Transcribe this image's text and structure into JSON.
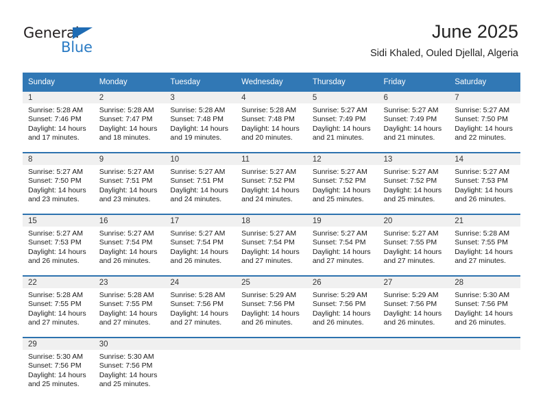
{
  "brand": {
    "name_top": "General",
    "name_bottom": "Blue",
    "accent_color": "#2a7bc4",
    "triangle_color": "#1f6cb4"
  },
  "header": {
    "title": "June 2025",
    "subtitle": "Sidi Khaled, Ouled Djellal, Algeria"
  },
  "theme": {
    "header_bg": "#3178b5",
    "row_divider": "#2c72ae",
    "daynum_bg": "#f0f0f0"
  },
  "calendar": {
    "weekday_headers": [
      "Sunday",
      "Monday",
      "Tuesday",
      "Wednesday",
      "Thursday",
      "Friday",
      "Saturday"
    ],
    "weeks": [
      [
        {
          "day": "1",
          "sunrise": "Sunrise: 5:28 AM",
          "sunset": "Sunset: 7:46 PM",
          "daylight_1": "Daylight: 14 hours",
          "daylight_2": "and 17 minutes."
        },
        {
          "day": "2",
          "sunrise": "Sunrise: 5:28 AM",
          "sunset": "Sunset: 7:47 PM",
          "daylight_1": "Daylight: 14 hours",
          "daylight_2": "and 18 minutes."
        },
        {
          "day": "3",
          "sunrise": "Sunrise: 5:28 AM",
          "sunset": "Sunset: 7:48 PM",
          "daylight_1": "Daylight: 14 hours",
          "daylight_2": "and 19 minutes."
        },
        {
          "day": "4",
          "sunrise": "Sunrise: 5:28 AM",
          "sunset": "Sunset: 7:48 PM",
          "daylight_1": "Daylight: 14 hours",
          "daylight_2": "and 20 minutes."
        },
        {
          "day": "5",
          "sunrise": "Sunrise: 5:27 AM",
          "sunset": "Sunset: 7:49 PM",
          "daylight_1": "Daylight: 14 hours",
          "daylight_2": "and 21 minutes."
        },
        {
          "day": "6",
          "sunrise": "Sunrise: 5:27 AM",
          "sunset": "Sunset: 7:49 PM",
          "daylight_1": "Daylight: 14 hours",
          "daylight_2": "and 21 minutes."
        },
        {
          "day": "7",
          "sunrise": "Sunrise: 5:27 AM",
          "sunset": "Sunset: 7:50 PM",
          "daylight_1": "Daylight: 14 hours",
          "daylight_2": "and 22 minutes."
        }
      ],
      [
        {
          "day": "8",
          "sunrise": "Sunrise: 5:27 AM",
          "sunset": "Sunset: 7:50 PM",
          "daylight_1": "Daylight: 14 hours",
          "daylight_2": "and 23 minutes."
        },
        {
          "day": "9",
          "sunrise": "Sunrise: 5:27 AM",
          "sunset": "Sunset: 7:51 PM",
          "daylight_1": "Daylight: 14 hours",
          "daylight_2": "and 23 minutes."
        },
        {
          "day": "10",
          "sunrise": "Sunrise: 5:27 AM",
          "sunset": "Sunset: 7:51 PM",
          "daylight_1": "Daylight: 14 hours",
          "daylight_2": "and 24 minutes."
        },
        {
          "day": "11",
          "sunrise": "Sunrise: 5:27 AM",
          "sunset": "Sunset: 7:52 PM",
          "daylight_1": "Daylight: 14 hours",
          "daylight_2": "and 24 minutes."
        },
        {
          "day": "12",
          "sunrise": "Sunrise: 5:27 AM",
          "sunset": "Sunset: 7:52 PM",
          "daylight_1": "Daylight: 14 hours",
          "daylight_2": "and 25 minutes."
        },
        {
          "day": "13",
          "sunrise": "Sunrise: 5:27 AM",
          "sunset": "Sunset: 7:52 PM",
          "daylight_1": "Daylight: 14 hours",
          "daylight_2": "and 25 minutes."
        },
        {
          "day": "14",
          "sunrise": "Sunrise: 5:27 AM",
          "sunset": "Sunset: 7:53 PM",
          "daylight_1": "Daylight: 14 hours",
          "daylight_2": "and 26 minutes."
        }
      ],
      [
        {
          "day": "15",
          "sunrise": "Sunrise: 5:27 AM",
          "sunset": "Sunset: 7:53 PM",
          "daylight_1": "Daylight: 14 hours",
          "daylight_2": "and 26 minutes."
        },
        {
          "day": "16",
          "sunrise": "Sunrise: 5:27 AM",
          "sunset": "Sunset: 7:54 PM",
          "daylight_1": "Daylight: 14 hours",
          "daylight_2": "and 26 minutes."
        },
        {
          "day": "17",
          "sunrise": "Sunrise: 5:27 AM",
          "sunset": "Sunset: 7:54 PM",
          "daylight_1": "Daylight: 14 hours",
          "daylight_2": "and 26 minutes."
        },
        {
          "day": "18",
          "sunrise": "Sunrise: 5:27 AM",
          "sunset": "Sunset: 7:54 PM",
          "daylight_1": "Daylight: 14 hours",
          "daylight_2": "and 27 minutes."
        },
        {
          "day": "19",
          "sunrise": "Sunrise: 5:27 AM",
          "sunset": "Sunset: 7:54 PM",
          "daylight_1": "Daylight: 14 hours",
          "daylight_2": "and 27 minutes."
        },
        {
          "day": "20",
          "sunrise": "Sunrise: 5:27 AM",
          "sunset": "Sunset: 7:55 PM",
          "daylight_1": "Daylight: 14 hours",
          "daylight_2": "and 27 minutes."
        },
        {
          "day": "21",
          "sunrise": "Sunrise: 5:28 AM",
          "sunset": "Sunset: 7:55 PM",
          "daylight_1": "Daylight: 14 hours",
          "daylight_2": "and 27 minutes."
        }
      ],
      [
        {
          "day": "22",
          "sunrise": "Sunrise: 5:28 AM",
          "sunset": "Sunset: 7:55 PM",
          "daylight_1": "Daylight: 14 hours",
          "daylight_2": "and 27 minutes."
        },
        {
          "day": "23",
          "sunrise": "Sunrise: 5:28 AM",
          "sunset": "Sunset: 7:55 PM",
          "daylight_1": "Daylight: 14 hours",
          "daylight_2": "and 27 minutes."
        },
        {
          "day": "24",
          "sunrise": "Sunrise: 5:28 AM",
          "sunset": "Sunset: 7:56 PM",
          "daylight_1": "Daylight: 14 hours",
          "daylight_2": "and 27 minutes."
        },
        {
          "day": "25",
          "sunrise": "Sunrise: 5:29 AM",
          "sunset": "Sunset: 7:56 PM",
          "daylight_1": "Daylight: 14 hours",
          "daylight_2": "and 26 minutes."
        },
        {
          "day": "26",
          "sunrise": "Sunrise: 5:29 AM",
          "sunset": "Sunset: 7:56 PM",
          "daylight_1": "Daylight: 14 hours",
          "daylight_2": "and 26 minutes."
        },
        {
          "day": "27",
          "sunrise": "Sunrise: 5:29 AM",
          "sunset": "Sunset: 7:56 PM",
          "daylight_1": "Daylight: 14 hours",
          "daylight_2": "and 26 minutes."
        },
        {
          "day": "28",
          "sunrise": "Sunrise: 5:30 AM",
          "sunset": "Sunset: 7:56 PM",
          "daylight_1": "Daylight: 14 hours",
          "daylight_2": "and 26 minutes."
        }
      ],
      [
        {
          "day": "29",
          "sunrise": "Sunrise: 5:30 AM",
          "sunset": "Sunset: 7:56 PM",
          "daylight_1": "Daylight: 14 hours",
          "daylight_2": "and 25 minutes."
        },
        {
          "day": "30",
          "sunrise": "Sunrise: 5:30 AM",
          "sunset": "Sunset: 7:56 PM",
          "daylight_1": "Daylight: 14 hours",
          "daylight_2": "and 25 minutes."
        },
        {
          "day": "",
          "sunrise": "",
          "sunset": "",
          "daylight_1": "",
          "daylight_2": ""
        },
        {
          "day": "",
          "sunrise": "",
          "sunset": "",
          "daylight_1": "",
          "daylight_2": ""
        },
        {
          "day": "",
          "sunrise": "",
          "sunset": "",
          "daylight_1": "",
          "daylight_2": ""
        },
        {
          "day": "",
          "sunrise": "",
          "sunset": "",
          "daylight_1": "",
          "daylight_2": ""
        },
        {
          "day": "",
          "sunrise": "",
          "sunset": "",
          "daylight_1": "",
          "daylight_2": ""
        }
      ]
    ]
  }
}
